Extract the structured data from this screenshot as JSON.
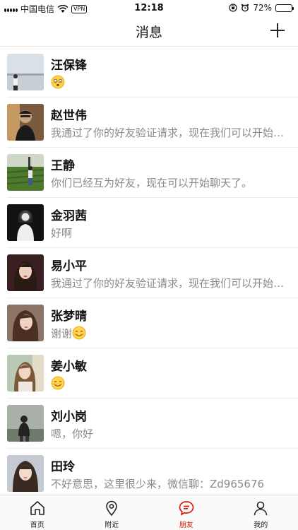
{
  "status_bar": {
    "carrier": "中国电信",
    "vpn": "VPN",
    "time": "12:18",
    "battery_text": "72%",
    "battery_level": 0.72
  },
  "header": {
    "title": "消息",
    "add_icon": "plus-icon"
  },
  "messages": [
    {
      "name": "汪保锋",
      "preview": "",
      "emoji": "dizzy-face"
    },
    {
      "name": "赵世伟",
      "preview": "我通过了你的好友验证请求，现在我们可以开始聊天了"
    },
    {
      "name": "王静",
      "preview": "你们已经互为好友，现在可以开始聊天了。"
    },
    {
      "name": "金羽茜",
      "preview": "好啊"
    },
    {
      "name": "易小平",
      "preview": "我通过了你的好友验证请求，现在我们可以开始聊天了"
    },
    {
      "name": "张梦晴",
      "preview": "谢谢",
      "emoji": "smile"
    },
    {
      "name": "姜小敏",
      "preview": "",
      "emoji": "smile"
    },
    {
      "name": "刘小岗",
      "preview": "嗯，你好"
    },
    {
      "name": "田玲",
      "preview": "不好意思，这里很少来，微信聊：Zd965676"
    }
  ],
  "tabs": [
    {
      "label": "首页",
      "icon": "home-icon",
      "active": false
    },
    {
      "label": "附近",
      "icon": "location-pin-icon",
      "active": false
    },
    {
      "label": "朋友",
      "icon": "chat-bubble-icon",
      "active": true
    },
    {
      "label": "我的",
      "icon": "person-icon",
      "active": false
    }
  ],
  "colors": {
    "accent": "#d81e06",
    "preview_text": "#8a8a8a",
    "divider": "#ececec"
  }
}
